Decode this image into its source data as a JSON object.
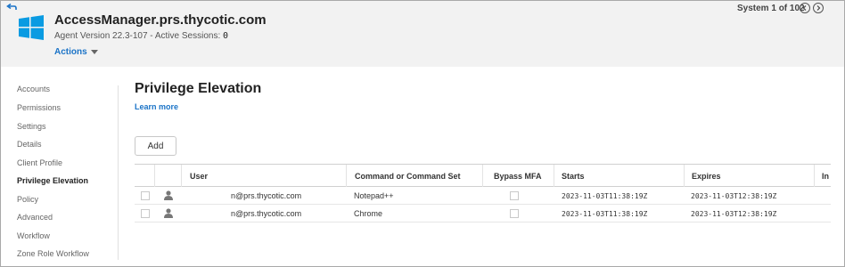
{
  "header": {
    "system_name": "AccessManager.prs.thycotic.com",
    "agent_label": "Agent Version 22.3-107 - Active Sessions: ",
    "active_sessions": "0",
    "actions_label": "Actions",
    "pager_text": "System 1 of 102"
  },
  "sidebar": {
    "items": [
      {
        "label": "Accounts"
      },
      {
        "label": "Permissions"
      },
      {
        "label": "Settings"
      },
      {
        "label": "Details"
      },
      {
        "label": "Client Profile"
      },
      {
        "label": "Privilege Elevation",
        "active": true
      },
      {
        "label": "Policy"
      },
      {
        "label": "Advanced"
      },
      {
        "label": "Workflow"
      },
      {
        "label": "Zone Role Workflow"
      }
    ]
  },
  "main": {
    "title": "Privilege Elevation",
    "learn_more": "Learn more",
    "add_label": "Add",
    "columns": [
      "User",
      "Command or Command Set",
      "Bypass MFA",
      "Starts",
      "Expires",
      "In"
    ],
    "rows": [
      {
        "user": "n@prs.thycotic.com",
        "command": "Notepad++",
        "starts": "2023-11-03T11:38:19Z",
        "expires": "2023-11-03T12:38:19Z"
      },
      {
        "user": "n@prs.thycotic.com",
        "command": "Chrome",
        "starts": "2023-11-03T11:38:19Z",
        "expires": "2023-11-03T12:38:19Z"
      }
    ]
  },
  "colors": {
    "accent": "#1a73c7",
    "windows_blue": "#0a9be2",
    "header_bg": "#f2f2f2"
  },
  "icons": {
    "back": "back-arrow-icon",
    "logo": "windows-logo-icon",
    "prev": "chevron-left-icon",
    "next": "chevron-right-icon",
    "user": "user-icon",
    "actions_caret": "chevron-down-icon"
  }
}
